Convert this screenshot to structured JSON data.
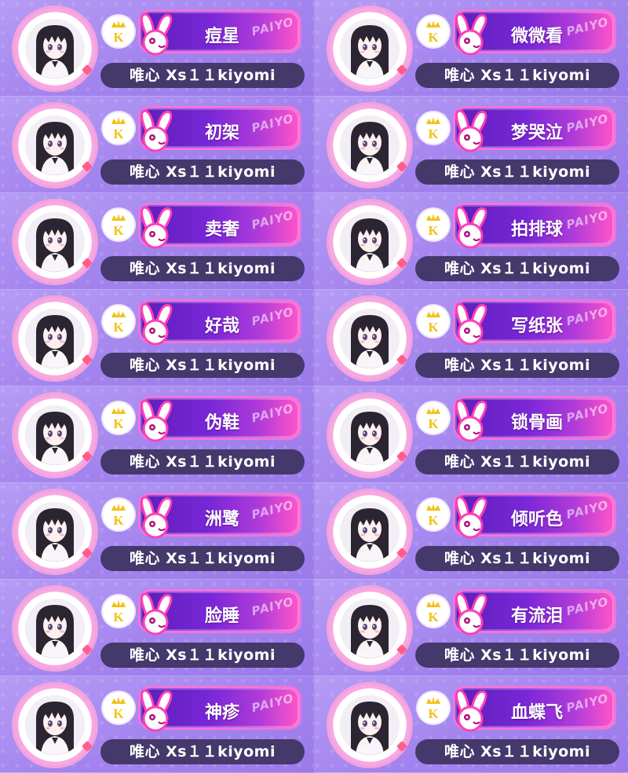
{
  "badge_letter": "K",
  "brand_text": "PAIYO",
  "colors": {
    "background": "#a98cf0",
    "plate_start": "#5c1fb8",
    "plate_end": "#ff55c9",
    "pill": "#45386b",
    "ring": "#f3a2dc",
    "crown": "#f2c21b"
  },
  "icons": {
    "avatar": "anime-girl-avatar",
    "badge": "crown-k-icon",
    "mascot": "pink-bunny-icon"
  },
  "cards": [
    {
      "title": "痘星",
      "username": "唯心 Xs１１kiyomi"
    },
    {
      "title": "微微看",
      "username": "唯心 Xs１１kiyomi"
    },
    {
      "title": "初架",
      "username": "唯心 Xs１１kiyomi"
    },
    {
      "title": "梦哭泣",
      "username": "唯心 Xs１１kiyomi"
    },
    {
      "title": "卖奢",
      "username": "唯心 Xs１１kiyomi"
    },
    {
      "title": "拍排球",
      "username": "唯心 Xs１１kiyomi"
    },
    {
      "title": "好哉",
      "username": "唯心 Xs１１kiyomi"
    },
    {
      "title": "写纸张",
      "username": "唯心 Xs１１kiyomi"
    },
    {
      "title": "伪鞋",
      "username": "唯心 Xs１１kiyomi"
    },
    {
      "title": "锁骨画",
      "username": "唯心 Xs１１kiyomi"
    },
    {
      "title": "洲鹭",
      "username": "唯心 Xs１１kiyomi"
    },
    {
      "title": "倾听色",
      "username": "唯心 Xs１１kiyomi"
    },
    {
      "title": "脸睡",
      "username": "唯心 Xs１１kiyomi"
    },
    {
      "title": "有流泪",
      "username": "唯心 Xs１１kiyomi"
    },
    {
      "title": "神疹",
      "username": "唯心 Xs１１kiyomi"
    },
    {
      "title": "血蝶飞",
      "username": "唯心 Xs１１kiyomi"
    }
  ]
}
